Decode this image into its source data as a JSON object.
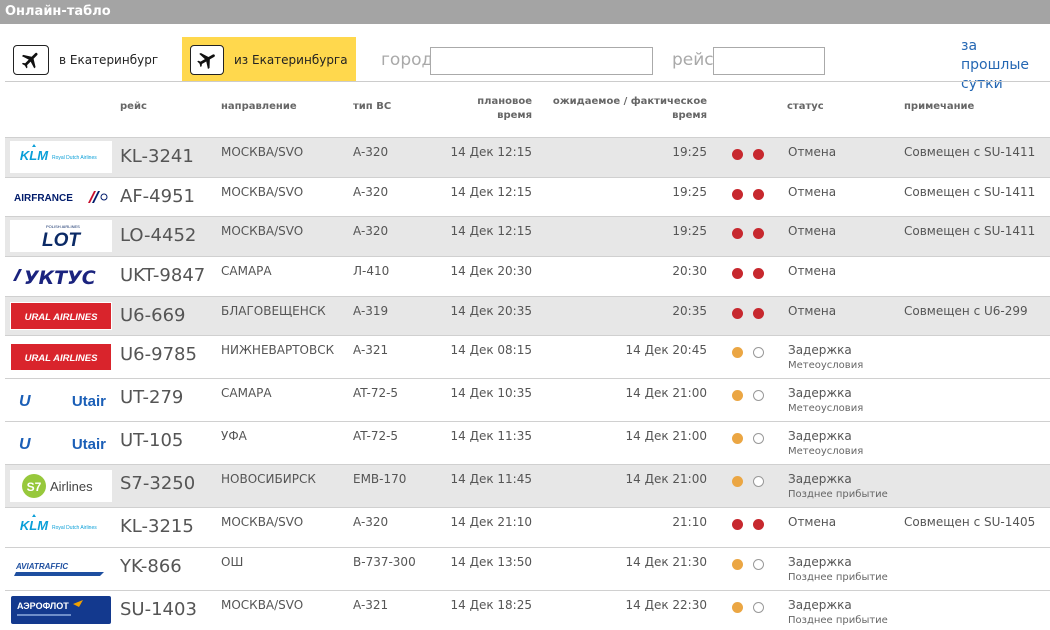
{
  "header": {
    "title": "Онлайн-табло"
  },
  "tabs": {
    "arrivals": "в Екатеринбург",
    "departures": "из Екатеринбурга"
  },
  "filters": {
    "city_label": "город",
    "city_value": "",
    "flight_label": "рейс",
    "flight_value": ""
  },
  "previous_link": "за прошлые сутки",
  "columns": {
    "flight": "рейс",
    "direction": "направление",
    "aircraft": "тип ВС",
    "scheduled": [
      "плановое",
      "время"
    ],
    "actual": [
      "ожидаемое / фактическое",
      "время"
    ],
    "status": "статус",
    "note": "примечание"
  },
  "colors": {
    "red": "#c7282e",
    "amber": "#eba643",
    "tab_active": "#ffd84d",
    "link": "#2467b3"
  },
  "flights": [
    {
      "airline": "KLM",
      "logo": "klm",
      "logo_sub": "Royal Dutch Airlines",
      "flight": "KL-3241",
      "direction": "МОСКВА/SVO",
      "aircraft": "A-320",
      "scheduled": "14 Дек 12:15",
      "actual": "19:25",
      "lights": [
        "red",
        "red"
      ],
      "status": "Отмена",
      "status_note": "",
      "note": "Совмещен с SU-1411"
    },
    {
      "airline": "AIRFRANCE",
      "logo": "airfrance",
      "logo_sub": "",
      "flight": "AF-4951",
      "direction": "МОСКВА/SVO",
      "aircraft": "A-320",
      "scheduled": "14 Дек 12:15",
      "actual": "19:25",
      "lights": [
        "red",
        "red"
      ],
      "status": "Отмена",
      "status_note": "",
      "note": "Совмещен с SU-1411"
    },
    {
      "airline": "LOT",
      "logo": "lot",
      "logo_sub": "POLISH AIRLINES",
      "flight": "LO-4452",
      "direction": "МОСКВА/SVO",
      "aircraft": "A-320",
      "scheduled": "14 Дек 12:15",
      "actual": "19:25",
      "lights": [
        "red",
        "red"
      ],
      "status": "Отмена",
      "status_note": "",
      "note": "Совмещен с SU-1411"
    },
    {
      "airline": "УКТУС",
      "logo": "uktus",
      "logo_sub": "",
      "flight": "UKT-9847",
      "direction": "САМАРА",
      "aircraft": "Л-410",
      "scheduled": "14 Дек 20:30",
      "actual": "20:30",
      "lights": [
        "red",
        "red"
      ],
      "status": "Отмена",
      "status_note": "",
      "note": ""
    },
    {
      "airline": "URAL AIRLINES",
      "logo": "ural",
      "logo_sub": "",
      "flight": "U6-669",
      "direction": "БЛАГОВЕЩЕНСК",
      "aircraft": "A-319",
      "scheduled": "14 Дек 20:35",
      "actual": "20:35",
      "lights": [
        "red",
        "red"
      ],
      "status": "Отмена",
      "status_note": "",
      "note": "Совмещен с U6-299"
    },
    {
      "airline": "URAL AIRLINES",
      "logo": "ural",
      "logo_sub": "",
      "flight": "U6-9785",
      "direction": "НИЖНЕВАРТОВСК",
      "aircraft": "A-321",
      "scheduled": "14 Дек 08:15",
      "actual": "14 Дек 20:45",
      "lights": [
        "amber",
        "empty"
      ],
      "status": "Задержка",
      "status_note": "Метеоусловия",
      "note": ""
    },
    {
      "airline": "Utair",
      "logo": "utair",
      "logo_sub": "",
      "flight": "UT-279",
      "direction": "САМАРА",
      "aircraft": "AT-72-5",
      "scheduled": "14 Дек 10:35",
      "actual": "14 Дек 21:00",
      "lights": [
        "amber",
        "empty"
      ],
      "status": "Задержка",
      "status_note": "Метеоусловия",
      "note": ""
    },
    {
      "airline": "Utair",
      "logo": "utair",
      "logo_sub": "",
      "flight": "UT-105",
      "direction": "УФА",
      "aircraft": "AT-72-5",
      "scheduled": "14 Дек 11:35",
      "actual": "14 Дек 21:00",
      "lights": [
        "amber",
        "empty"
      ],
      "status": "Задержка",
      "status_note": "Метеоусловия",
      "note": ""
    },
    {
      "airline": "Airlines",
      "logo": "s7",
      "logo_sub": "",
      "flight": "S7-3250",
      "direction": "НОВОСИБИРСК",
      "aircraft": "EMB-170",
      "scheduled": "14 Дек 11:45",
      "actual": "14 Дек 21:00",
      "lights": [
        "amber",
        "empty"
      ],
      "status": "Задержка",
      "status_note": "Позднее прибытие",
      "note": ""
    },
    {
      "airline": "KLM",
      "logo": "klm",
      "logo_sub": "Royal Dutch Airlines",
      "flight": "KL-3215",
      "direction": "МОСКВА/SVO",
      "aircraft": "A-320",
      "scheduled": "14 Дек 21:10",
      "actual": "21:10",
      "lights": [
        "red",
        "red"
      ],
      "status": "Отмена",
      "status_note": "",
      "note": "Совмещен с SU-1405"
    },
    {
      "airline": "AVIATRAFFIC",
      "logo": "avia",
      "logo_sub": "",
      "flight": "YK-866",
      "direction": "ОШ",
      "aircraft": "B-737-300",
      "scheduled": "14 Дек 13:50",
      "actual": "14 Дек 21:30",
      "lights": [
        "amber",
        "empty"
      ],
      "status": "Задержка",
      "status_note": "Позднее прибытие",
      "note": ""
    },
    {
      "airline": "АЭРОФЛОТ",
      "logo": "aeroflot",
      "logo_sub": "",
      "flight": "SU-1403",
      "direction": "МОСКВА/SVO",
      "aircraft": "A-321",
      "scheduled": "14 Дек 18:25",
      "actual": "14 Дек 22:30",
      "lights": [
        "amber",
        "empty"
      ],
      "status": "Задержка",
      "status_note": "Позднее прибытие",
      "note": ""
    }
  ]
}
